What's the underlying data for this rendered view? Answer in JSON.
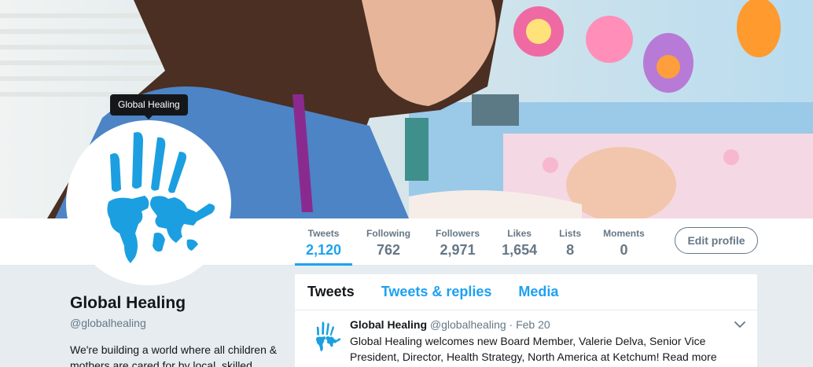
{
  "profile": {
    "name": "Global Healing",
    "handle": "@globalhealing",
    "bio": "We're building a world where all children & mothers are cared for by local, skilled",
    "tooltip": "Global Healing"
  },
  "stats": [
    {
      "label": "Tweets",
      "value": "2,120"
    },
    {
      "label": "Following",
      "value": "762"
    },
    {
      "label": "Followers",
      "value": "2,971"
    },
    {
      "label": "Likes",
      "value": "1,654"
    },
    {
      "label": "Lists",
      "value": "8"
    },
    {
      "label": "Moments",
      "value": "0"
    }
  ],
  "edit_profile_label": "Edit profile",
  "tabs": [
    {
      "label": "Tweets"
    },
    {
      "label": "Tweets & replies"
    },
    {
      "label": "Media"
    }
  ],
  "tweet": {
    "name": "Global Healing",
    "handle": "@globalhealing",
    "separator": "·",
    "date": "Feb 20",
    "text": "Global Healing welcomes new Board Member, Valerie Delva, Senior Vice President, Director, Health Strategy, North America at Ketchum! Read more about"
  },
  "colors": {
    "accent": "#1da1f2",
    "logo_blue": "#1b9fe0",
    "muted": "#657786",
    "text": "#14171a",
    "background": "#e6ecf0"
  },
  "icons": {
    "logo": "handprint-world-map-logo",
    "caret": "chevron-down-icon"
  }
}
